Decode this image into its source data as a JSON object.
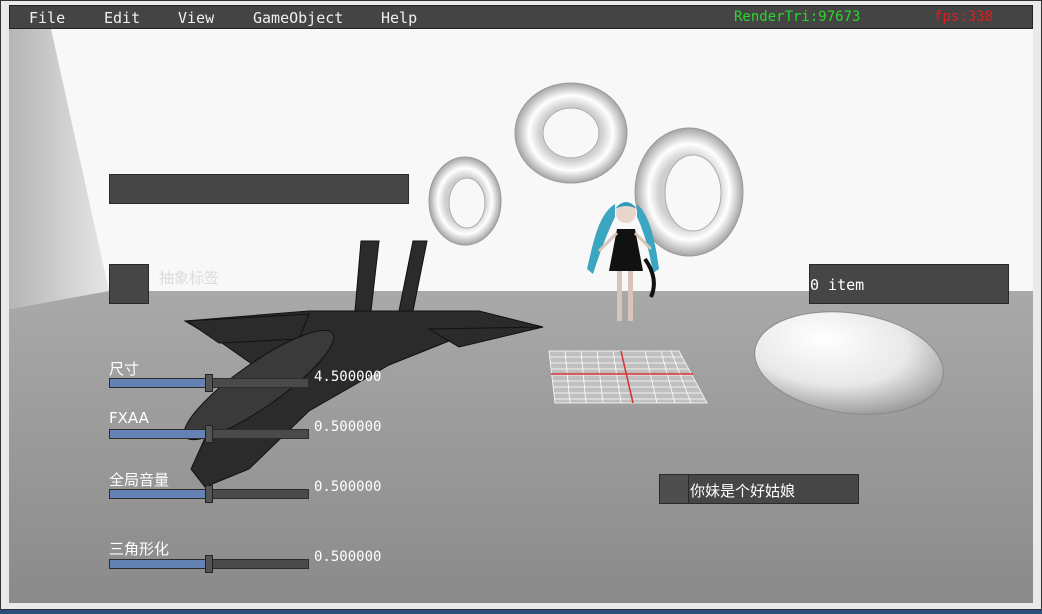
{
  "menu": {
    "items": [
      "File",
      "Edit",
      "View",
      "GameObject",
      "Help"
    ],
    "render_tri": "RenderTri:97673",
    "fps": "fps:338"
  },
  "gui": {
    "checkbox_label": "抽象标签",
    "list_text": "0 item",
    "button_text": "你妹是个好姑娘"
  },
  "sliders": [
    {
      "label": "尺寸",
      "value_text": "4.500000",
      "fraction": 0.5
    },
    {
      "label": "FXAA",
      "value_text": "0.500000",
      "fraction": 0.5
    },
    {
      "label": "全局音量",
      "value_text": "0.500000",
      "fraction": 0.5
    },
    {
      "label": "三角形化",
      "value_text": "0.500000",
      "fraction": 0.5
    }
  ],
  "colors": {
    "render_tri": "#2bd62b",
    "fps": "#d81f1f",
    "slider_fill": "#6482b4",
    "panel": "#464646"
  }
}
